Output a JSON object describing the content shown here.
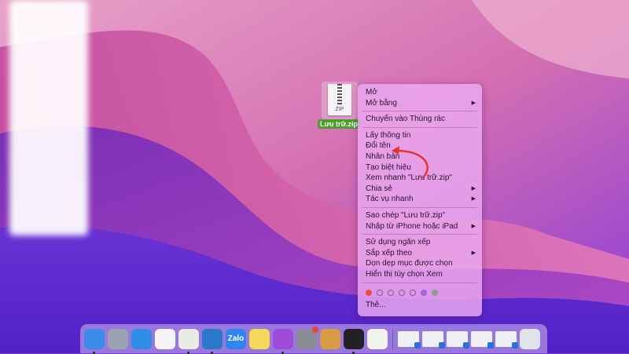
{
  "file": {
    "name": "Lưu trữ.zip",
    "icon_text": "ZIP",
    "label_color": "#4f9d2b"
  },
  "context_menu": {
    "groups": [
      [
        {
          "label": "Mở",
          "submenu": false
        },
        {
          "label": "Mở bằng",
          "submenu": true
        }
      ],
      [
        {
          "label": "Chuyển vào Thùng rác",
          "submenu": false
        }
      ],
      [
        {
          "label": "Lấy thông tin",
          "submenu": false
        },
        {
          "label": "Đổi tên",
          "submenu": false,
          "highlighted_by_annotation": true
        },
        {
          "label": "Nhân bản",
          "submenu": false
        },
        {
          "label": "Tạo biệt hiệu",
          "submenu": false
        },
        {
          "label": "Xem nhanh \"Lưu trữ.zip\"",
          "submenu": false
        },
        {
          "label": "Chia sẻ",
          "submenu": true
        },
        {
          "label": "Tác vụ nhanh",
          "submenu": true
        }
      ],
      [
        {
          "label": "Sao chép \"Lưu trữ.zip\"",
          "submenu": false
        },
        {
          "label": "Nhập từ iPhone hoặc iPad",
          "submenu": true
        }
      ],
      [
        {
          "label": "Sử dụng ngăn xếp",
          "submenu": false
        },
        {
          "label": "Sắp xếp theo",
          "submenu": true
        },
        {
          "label": "Dọn dẹp mục được chọn",
          "submenu": false
        },
        {
          "label": "Hiển thị tùy chọn Xem",
          "submenu": false
        }
      ]
    ],
    "tag_colors": [
      "#ef4d3b",
      "transparent",
      "transparent",
      "transparent",
      "transparent",
      "#9a6ad6",
      "#8f9c8a"
    ],
    "tags_label": "Thẻ..."
  },
  "annotation": {
    "arrow_color": "#e8322e",
    "target": "Đổi tên"
  },
  "dock": {
    "apps": [
      {
        "name": "finder-icon",
        "color": "#3b8ce8",
        "running": true,
        "text": ""
      },
      {
        "name": "launchpad-icon",
        "color": "#9aa3b3",
        "running": false,
        "text": ""
      },
      {
        "name": "safari-icon",
        "color": "#2f8fe6",
        "running": false,
        "text": ""
      },
      {
        "name": "reminders-icon",
        "color": "#f5f5f5",
        "running": false,
        "text": ""
      },
      {
        "name": "chrome-icon",
        "color": "#e9e9e9",
        "running": true,
        "text": ""
      },
      {
        "name": "vscode-icon",
        "color": "#2a78c9",
        "running": true,
        "text": ""
      },
      {
        "name": "zalo-icon",
        "color": "#2f86f0",
        "running": false,
        "text": "Zalo"
      },
      {
        "name": "notes-icon",
        "color": "#f6d85a",
        "running": false,
        "text": ""
      },
      {
        "name": "podcasts-icon",
        "color": "#a04ad8",
        "running": true,
        "text": ""
      },
      {
        "name": "system-preferences-icon",
        "color": "#8c8c96",
        "running": false,
        "text": ""
      },
      {
        "name": "preview-icon",
        "color": "#d79a45",
        "running": false,
        "text": ""
      },
      {
        "name": "terminal-icon",
        "color": "#222222",
        "running": true,
        "text": ""
      },
      {
        "name": "textedit-icon",
        "color": "#f2f2f2",
        "running": false,
        "text": ""
      }
    ],
    "windows": [
      "minimized-window-1",
      "minimized-window-2",
      "minimized-window-3",
      "minimized-window-4",
      "minimized-window-5"
    ],
    "trash": "trash-icon"
  }
}
